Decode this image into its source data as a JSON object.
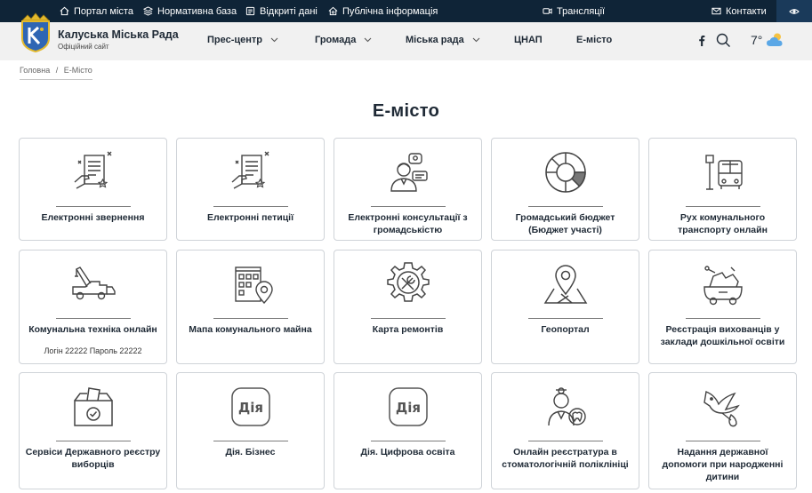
{
  "topbar": {
    "portal": "Портал міста",
    "normative": "Нормативна база",
    "open_data": "Відкриті дані",
    "public_info": "Публічна інформація",
    "broadcasts": "Трансляції",
    "contacts": "Контакти"
  },
  "header": {
    "title": "Калуська Міська Рада",
    "subtitle": "Офіційний сайт",
    "nav": [
      "Прес-центр",
      "Громада",
      "Міська рада",
      "ЦНАП",
      "Е-місто"
    ],
    "weather": "7°"
  },
  "breadcrumb": {
    "home": "Головна",
    "sep": "/",
    "current": "Е-Місто"
  },
  "page": {
    "title": "Е-місто"
  },
  "cards": [
    {
      "icon": "document-hand-icon",
      "label": "Електронні звернення"
    },
    {
      "icon": "document-hand-icon",
      "label": "Електронні петиції"
    },
    {
      "icon": "consultation-icon",
      "label": "Електронні консультації з громадськістю"
    },
    {
      "icon": "pie-chart-icon",
      "label": "Громадський бюджет (Бюджет участі)"
    },
    {
      "icon": "bus-stop-icon",
      "label": "Рух комунального транспорту онлайн"
    },
    {
      "icon": "crane-truck-icon",
      "label": "Комунальна техніка онлайн",
      "note": "Логін 22222 Пароль 22222"
    },
    {
      "icon": "building-location-icon",
      "label": "Мапа комунального майна"
    },
    {
      "icon": "repair-gear-icon",
      "label": "Карта ремонтів"
    },
    {
      "icon": "map-pin-icon",
      "label": "Геопортал"
    },
    {
      "icon": "toy-car-icon",
      "label": "Реєстрація вихованців у заклади дошкільної освіти"
    },
    {
      "icon": "ballot-box-icon",
      "label": "Сервіси Державного реєстру виборців"
    },
    {
      "icon": "diia-icon",
      "label": "Дія. Бізнес",
      "badge": "Дія"
    },
    {
      "icon": "diia-icon",
      "label": "Дія. Цифрова освіта",
      "badge": "Дія"
    },
    {
      "icon": "dentist-icon",
      "label": "Онлайн реєстратура в стоматологічній поліклініці"
    },
    {
      "icon": "stork-icon",
      "label": "Надання державної допомоги при народженні дитини"
    }
  ]
}
